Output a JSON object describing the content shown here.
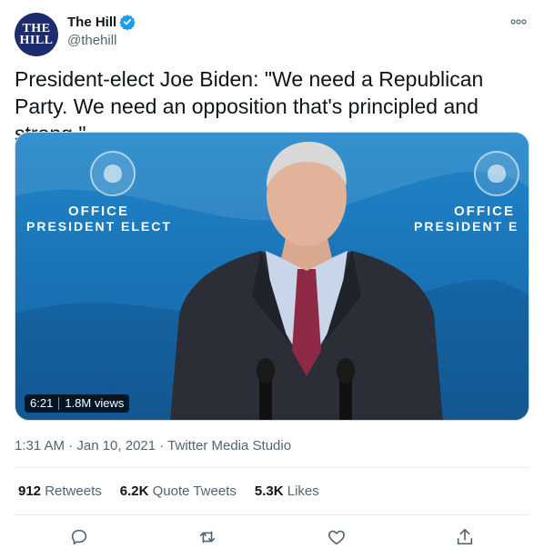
{
  "account": {
    "avatar_line1": "THE",
    "avatar_line2": "HILL",
    "display_name": "The Hill",
    "handle": "@thehill",
    "verified": true
  },
  "tweet": {
    "text": "President-elect Joe Biden: \"We need a Republican Party. We need an opposition that's principled and strong.\""
  },
  "media": {
    "video_duration": "6:21",
    "video_views": "1.8M views",
    "backdrop_left_line1": "OFFICE",
    "backdrop_left_line2": "PRESIDENT ELECT",
    "backdrop_right_line1": "OFFICE",
    "backdrop_right_line2": "PRESIDENT E"
  },
  "meta": {
    "line": "1:31 AM · Jan 10, 2021 · Twitter Media Studio"
  },
  "stats": {
    "retweets_count": "912",
    "retweets_label": "Retweets",
    "quotes_count": "6.2K",
    "quotes_label": "Quote Tweets",
    "likes_count": "5.3K",
    "likes_label": "Likes"
  },
  "actions": [
    "reply-icon",
    "retweet-icon",
    "like-icon",
    "share-icon"
  ],
  "colors": {
    "verified_blue": "#1d9bf0",
    "text_primary": "#0f1419",
    "text_secondary": "#536471",
    "avatar_bg": "#1d2c6e"
  }
}
